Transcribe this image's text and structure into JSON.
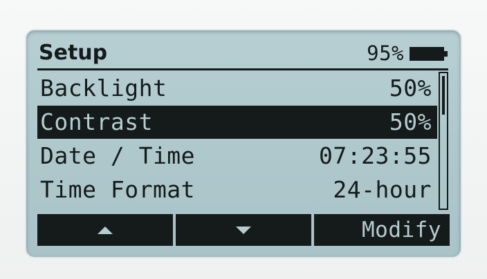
{
  "header": {
    "title": "Setup",
    "battery_percent": "95%",
    "battery_icon": "battery-full-icon"
  },
  "settings": [
    {
      "label": "Backlight",
      "value": "50%"
    },
    {
      "label": "Contrast",
      "value": "50%"
    },
    {
      "label": "Date / Time",
      "value": "07:23:55"
    },
    {
      "label": "Time Format",
      "value": "24-hour"
    }
  ],
  "selected_index": 1,
  "softkeys": {
    "up_icon": "arrow-up-icon",
    "down_icon": "arrow-down-icon",
    "modify_label": "Modify"
  },
  "colors": {
    "lcd_background": "#aec8cc",
    "lcd_ink": "#151a1b"
  }
}
